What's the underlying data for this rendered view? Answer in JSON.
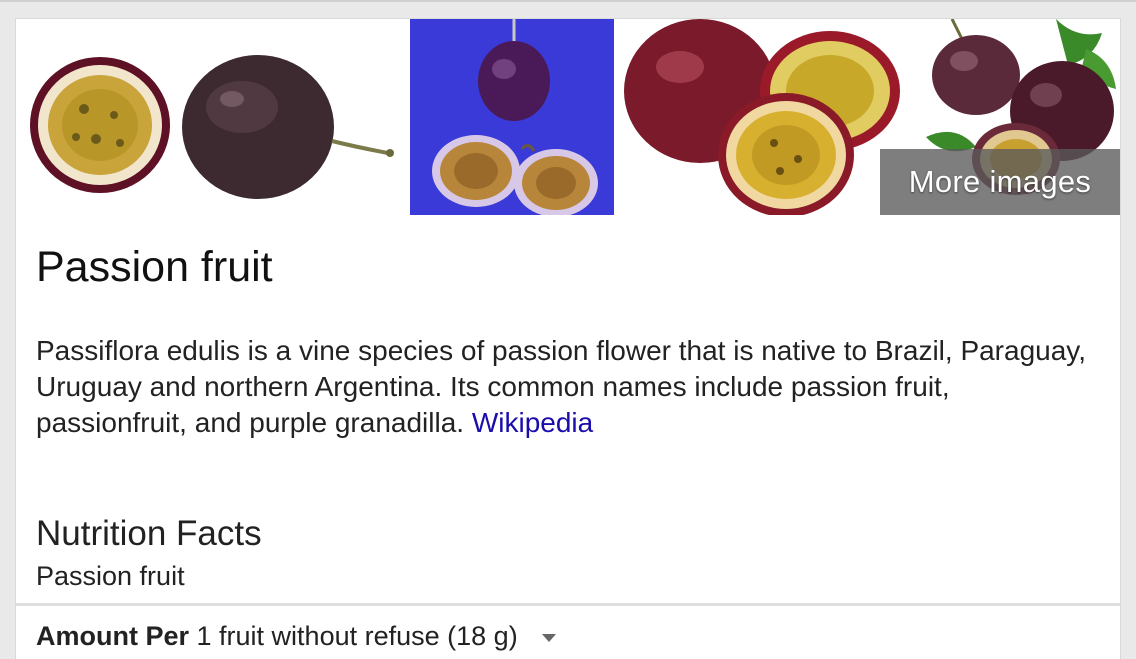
{
  "images": {
    "more_label": "More images"
  },
  "entity": {
    "title": "Passion fruit",
    "description": "Passiflora edulis is a vine species of passion flower that is native to Brazil, Paraguay, Uruguay and northern Argentina. Its common names include passion fruit, passionfruit, and purple granadilla.",
    "source_link": "Wikipedia"
  },
  "nutrition": {
    "heading": "Nutrition Facts",
    "subtitle": "Passion fruit",
    "amount_label": "Amount Per",
    "serving_selected": "1 fruit without refuse (18 g)"
  },
  "colors": {
    "link": "#1a0dab",
    "tile2_background": "#3a3ad8"
  }
}
